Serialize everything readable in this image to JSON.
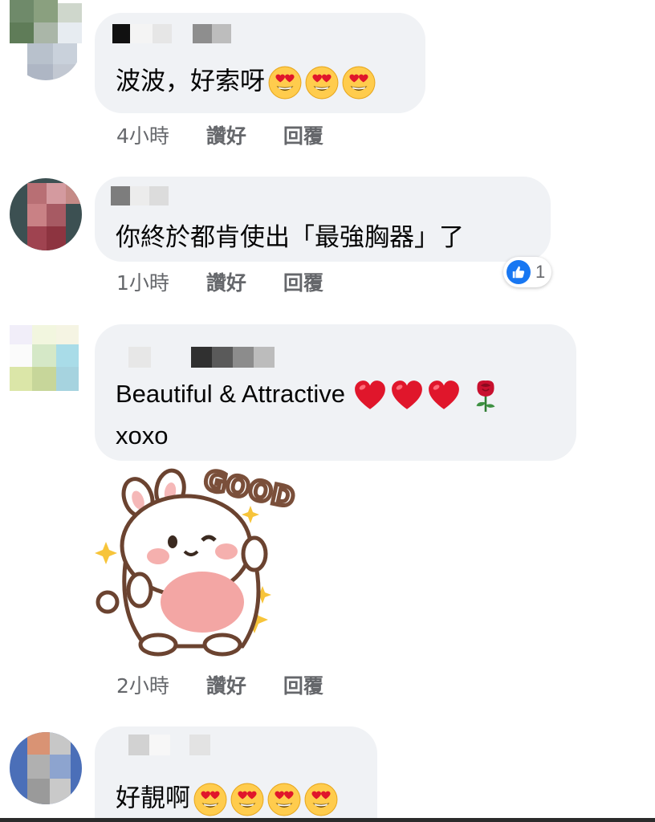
{
  "comments": [
    {
      "text": "波波，好索呀",
      "emoji": [
        "heart-eyes-emoji",
        "heart-eyes-emoji",
        "heart-eyes-emoji"
      ],
      "time": "4小時",
      "like_label": "讚好",
      "reply_label": "回覆"
    },
    {
      "text": "你終於都肯使出「最強胸器」了",
      "time": "1小時",
      "like_label": "讚好",
      "reply_label": "回覆",
      "reaction": {
        "icon": "thumbs-up-icon",
        "count": "1"
      }
    },
    {
      "text_line1": "Beautiful & Attractive",
      "emoji": [
        "red-heart-emoji",
        "red-heart-emoji",
        "red-heart-emoji",
        "rose-emoji"
      ],
      "text_line2": "xoxo",
      "sticker": {
        "icon": "good-bunny-sticker",
        "caption": "GOOD"
      },
      "time": "2小時",
      "like_label": "讚好",
      "reply_label": "回覆"
    },
    {
      "text": "好靚啊",
      "emoji": [
        "heart-eyes-emoji",
        "heart-eyes-emoji",
        "heart-eyes-emoji",
        "heart-eyes-emoji"
      ]
    }
  ],
  "colors": {
    "bubble": "#f0f2f5",
    "meta_text": "#65676b",
    "like_blue": "#1877f2",
    "heart_red": "#e0162b"
  }
}
